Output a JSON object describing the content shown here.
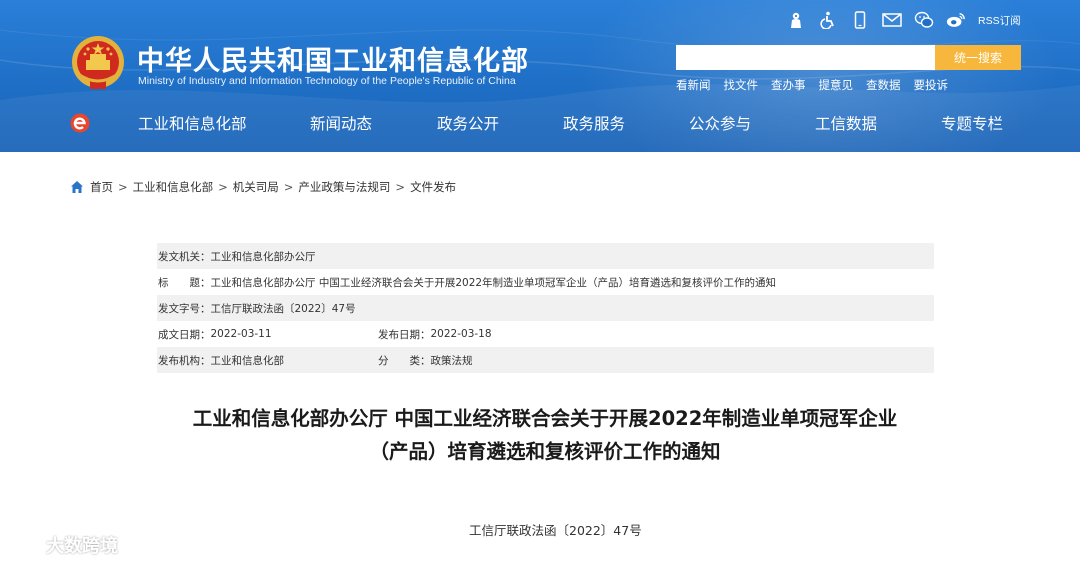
{
  "header": {
    "title": "中华人民共和国工业和信息化部",
    "subtitle": "Ministry of Industry and Information Technology of the People's Republic of China",
    "top_icons": [
      "child-icon",
      "accessibility-icon",
      "mobile-icon",
      "mail-icon",
      "wechat-icon",
      "weibo-icon"
    ],
    "rss_label": "RSS订阅",
    "search": {
      "placeholder": "",
      "button_label": "统一搜索"
    },
    "quick_links": [
      "看新闻",
      "找文件",
      "查办事",
      "提意见",
      "查数据",
      "要投诉"
    ],
    "nav": [
      "工业和信息化部",
      "新闻动态",
      "政务公开",
      "政务服务",
      "公众参与",
      "工信数据",
      "专题专栏"
    ],
    "colors": {
      "header_blue": "#1f6fc6",
      "search_orange": "#f6b73c"
    }
  },
  "breadcrumb": [
    "首页",
    "工业和信息化部",
    "机关司局",
    "产业政策与法规司",
    "文件发布"
  ],
  "info": {
    "issuer_label": "发文机关：",
    "issuer": "工业和信息化部办公厅",
    "title_label": "标　　题：",
    "title": "工业和信息化部办公厅 中国工业经济联合会关于开展2022年制造业单项冠军企业（产品）培育遴选和复核评价工作的通知",
    "docno_label": "发文字号：",
    "docno": "工信厅联政法函〔2022〕47号",
    "created_label": "成文日期：",
    "created": "2022-03-11",
    "published_label": "发布日期：",
    "published": "2022-03-18",
    "org_label": "发布机构：",
    "org": "工业和信息化部",
    "category_label": "分　　类：",
    "category": "政策法规"
  },
  "document": {
    "title_line1": "工业和信息化部办公厅 中国工业经济联合会关于开展2022年制造业单项冠军企业",
    "title_line2": "（产品）培育遴选和复核评价工作的通知",
    "number": "工信厅联政法函〔2022〕47号"
  },
  "watermark": "大数跨境"
}
